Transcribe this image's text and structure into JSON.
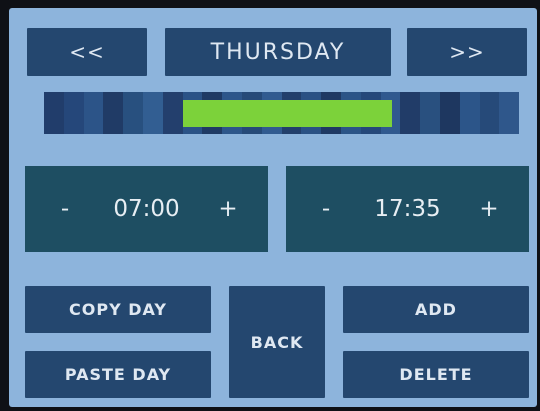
{
  "header": {
    "prev_label": "<<",
    "day": "THURSDAY",
    "next_label": ">>"
  },
  "timeline": {
    "segment_colors": [
      "#213d6b",
      "#25477a",
      "#2c5488",
      "#203b66",
      "#28507f",
      "#325e92",
      "#233f6d",
      "#2a5286",
      "#1f3a64",
      "#2d568a",
      "#264a78",
      "#315b90",
      "#223f6b",
      "#2a5184",
      "#1f3963",
      "#2b5487",
      "#25487a",
      "#30598f",
      "#213c68",
      "#29507f",
      "#1e3760",
      "#2c5589",
      "#264a79",
      "#2f578b"
    ],
    "active_color": "#7cd23a",
    "active_range": {
      "start": "07:00",
      "end": "17:35"
    }
  },
  "start_time": {
    "minus": "-",
    "value": "07:00",
    "plus": "+"
  },
  "end_time": {
    "minus": "-",
    "value": "17:35",
    "plus": "+"
  },
  "buttons": {
    "copy": "COPY DAY",
    "paste": "PASTE DAY",
    "back": "BACK",
    "add": "ADD",
    "delete": "DELETE"
  }
}
